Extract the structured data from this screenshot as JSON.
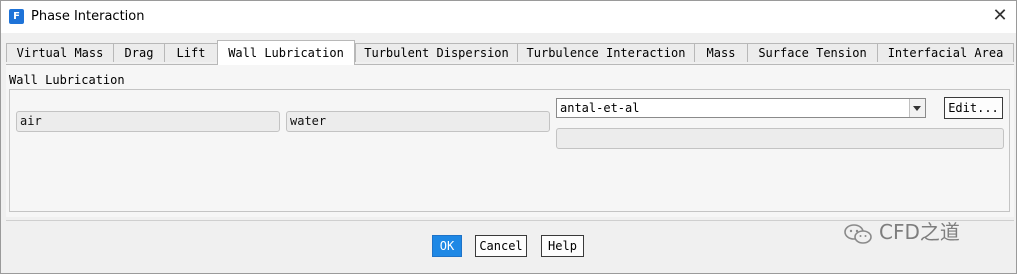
{
  "window": {
    "title": "Phase Interaction",
    "icon_letter": "F"
  },
  "tabs": [
    {
      "label": "Virtual Mass"
    },
    {
      "label": "Drag"
    },
    {
      "label": "Lift"
    },
    {
      "label": "Wall Lubrication"
    },
    {
      "label": "Turbulent Dispersion"
    },
    {
      "label": "Turbulence Interaction"
    },
    {
      "label": "Mass"
    },
    {
      "label": "Surface Tension"
    },
    {
      "label": "Interfacial Area"
    }
  ],
  "active_tab": "Wall Lubrication",
  "panel": {
    "group_label": "Wall Lubrication",
    "phase_1": "air",
    "phase_2": "water",
    "model_selected": "antal-et-al",
    "edit_label": "Edit...",
    "extra_field": ""
  },
  "footer": {
    "ok_label": "OK",
    "cancel_label": "Cancel",
    "help_label": "Help"
  },
  "watermark": {
    "text": "CFD之道"
  },
  "colors": {
    "accent": "#1e88e5",
    "window_bg": "#f0f0f0"
  }
}
